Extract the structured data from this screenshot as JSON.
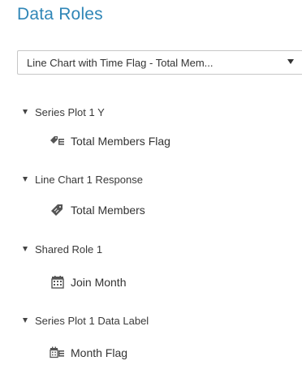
{
  "panel": {
    "title": "Data Roles",
    "object_select": {
      "value": "Line Chart with Time Flag - Total Mem..."
    },
    "roles": [
      {
        "label": "Series Plot 1 Y",
        "items": [
          {
            "label": "Total Members Flag",
            "icon": "measure-flag-icon"
          }
        ]
      },
      {
        "label": "Line Chart 1 Response",
        "items": [
          {
            "label": "Total Members",
            "icon": "measure-icon"
          }
        ]
      },
      {
        "label": "Shared Role 1",
        "items": [
          {
            "label": "Join Month",
            "icon": "calendar-icon"
          }
        ]
      },
      {
        "label": "Series Plot 1 Data Label",
        "items": [
          {
            "label": "Month Flag",
            "icon": "calendar-flag-icon"
          }
        ]
      }
    ]
  },
  "colors": {
    "title": "#2f86b7",
    "text": "#333333",
    "border": "#c7c7c7"
  }
}
